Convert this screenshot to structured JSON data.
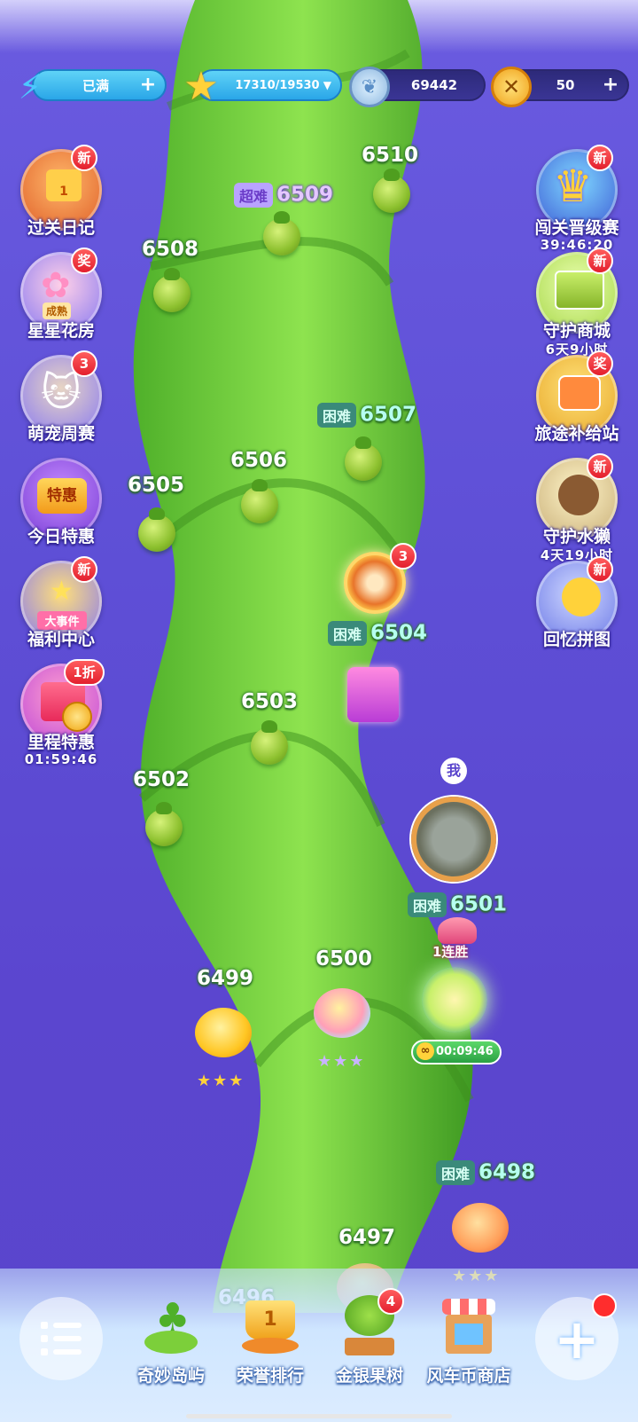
{
  "topbar": {
    "energy": "已满",
    "stars": "17310/19530",
    "gems": "69442",
    "coins": "50"
  },
  "left_buttons": [
    {
      "label": "过关日记",
      "badge": "新",
      "inner": "1"
    },
    {
      "label": "星星花房",
      "badge": "奖",
      "inner": "成熟"
    },
    {
      "label": "萌宠周赛",
      "badge": "3"
    },
    {
      "label": "今日特惠",
      "inner": "特惠"
    },
    {
      "label": "福利中心",
      "badge": "新",
      "inner": "大事件"
    },
    {
      "label": "里程特惠",
      "badge": "1折",
      "sub": "01:59:46"
    }
  ],
  "right_buttons": [
    {
      "label": "闯关晋级赛",
      "badge": "新",
      "sub": "39:46:20"
    },
    {
      "label": "守护商城",
      "badge": "新",
      "sub": "6天9小时"
    },
    {
      "label": "旅途补给站",
      "badge": "奖"
    },
    {
      "label": "守护水獭",
      "badge": "新",
      "sub": "4天19小时"
    },
    {
      "label": "回忆拼图",
      "badge": "新"
    }
  ],
  "levels": {
    "l6510": "6510",
    "l6509": "6509",
    "l6508": "6508",
    "l6507": "6507",
    "l6506": "6506",
    "l6505": "6505",
    "l6504": "6504",
    "l6503": "6503",
    "l6502": "6502",
    "l6501": "6501",
    "l6500": "6500",
    "l6499": "6499",
    "l6498": "6498",
    "l6497": "6497",
    "l6496": "6496"
  },
  "tags": {
    "hard": "困难",
    "super": "超难"
  },
  "spinner_badge": "3",
  "me_label": "我",
  "streak_label": "1连胜",
  "gift_timer": "00:09:46",
  "stars_6499": "★★★",
  "stars_6500": "★★★",
  "stars_6498": "★★★",
  "bottom_nav": [
    {
      "label": "奇妙岛屿"
    },
    {
      "label": "荣誉排行",
      "inner": "1"
    },
    {
      "label": "金银果树",
      "badge": "4"
    },
    {
      "label": "风车币商店"
    }
  ],
  "colors": {
    "background": "#5e4fd6",
    "stalk": "#6fcf3b",
    "badge": "#e31f2e"
  }
}
